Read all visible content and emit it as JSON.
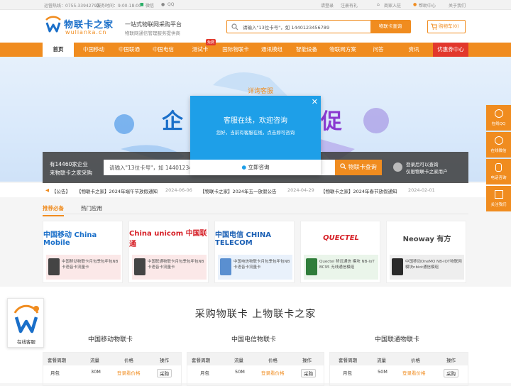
{
  "topbar": {
    "phone": "运营热线：0755-33942792",
    "hours": "服务时间：9:00-18:00",
    "wechat": "微信",
    "qq": "QQ",
    "login": "请登录",
    "register": "注册有礼",
    "seller": "商家入驻",
    "help": "帮助中心",
    "about": "关于我们"
  },
  "header": {
    "logo_title": "物联卡之家",
    "logo_domain": "wulianka.cn",
    "slogan": "一站式物联网采购平台",
    "slogan_sub": "物联网通信管理服务提供商",
    "search_placeholder": "请输入\"13位卡号\"，如 1440123456789",
    "search_button": "物联卡查询",
    "cart": "购物车(0)"
  },
  "nav": {
    "items": [
      "首页",
      "中国移动",
      "中国联通",
      "中国电信",
      "测试卡",
      "国际物联卡",
      "通讯模组",
      "智能设备",
      "物联网方案",
      "问答",
      "资讯",
      "优惠券中心"
    ],
    "hot_badge": "免费"
  },
  "banner": {
    "detail_tag": "详询客服",
    "left_text": "企",
    "right_text": "促",
    "query_line1": "有14460家企业",
    "query_line2": "来物联卡之家采购",
    "query_placeholder": "请输入\"13位卡号\"，如 1440123456789",
    "query_button": "物联卡查询",
    "login_line1": "登录后可以查询",
    "login_line2": "仅限物联卡之家用户"
  },
  "popup": {
    "title": "客服在线，欢迎咨询",
    "subtitle": "您好，当前有客服在线，点击即可咨询",
    "button": "立即咨询"
  },
  "notices": [
    {
      "text": "【物联卡之家】2024年端午节放假通知",
      "date": "2024-06-06"
    },
    {
      "text": "【物联卡之家】2024年五一放假公告",
      "date": "2024-04-29"
    },
    {
      "text": "【物联卡之家】2024年春节放假通知",
      "date": "2024-02-01"
    }
  ],
  "notice_label": "【公告】",
  "tabs": [
    "推荐必备",
    "热门应用"
  ],
  "brands": [
    {
      "name": "中国移动 China Mobile",
      "product": "中国移动物联卡月包季包年包NB卡语音卡流量卡",
      "color": "#1a6fc9"
    },
    {
      "name": "China unicom 中国联通",
      "product": "中国联通物联卡月包季包年包NB卡语音卡流量卡",
      "color": "#d61f26"
    },
    {
      "name": "中国电信 CHINA TELECOM",
      "product": "中国电信物联卡月包季包年包NB卡语音卡流量卡",
      "color": "#1a5fb4"
    },
    {
      "name": "QUECTEL",
      "product": "Quectel 移远通信 模块 NB-IoT BC95 无线通信模组",
      "color": "#d61f26"
    },
    {
      "name": "Neoway 有方",
      "product": "中国移动OneMO NB-IOT物联网模块nbiot通信模组",
      "color": "#444444"
    }
  ],
  "section": {
    "title": "采购物联卡 上物联卡之家",
    "operators": [
      {
        "name": "中国移动物联卡",
        "cycle": "月包",
        "flow": "30M",
        "price": "登录看价格",
        "op": "采购"
      },
      {
        "name": "中国电信物联卡",
        "cycle": "月包",
        "flow": "50M",
        "price": "登录看价格",
        "op": "采购"
      },
      {
        "name": "中国联通物联卡",
        "cycle": "月包",
        "flow": "50M",
        "price": "登录看价格",
        "op": "采购"
      }
    ],
    "headers": [
      "套餐周期",
      "流量",
      "价格",
      "操作"
    ]
  },
  "sidebar": [
    "在线QQ",
    "在线微信",
    "电话咨询",
    "关注我们"
  ],
  "cs_label": "在线客服",
  "colors": {
    "accent": "#f08c1f",
    "popup": "#1e9fe8",
    "coupon": "#e2382c"
  }
}
